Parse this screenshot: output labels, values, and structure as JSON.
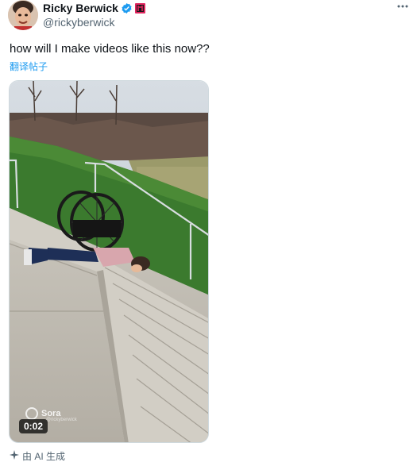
{
  "author": {
    "display_name": "Ricky Berwick",
    "handle": "@rickyberwick",
    "verified_icon": "verified-badge-icon",
    "affiliate_icon": "affiliate-badge-icon"
  },
  "more_icon": "more-options-icon",
  "tweet": {
    "text": "how will I make videos like this now??",
    "translate_label": "翻译帖子"
  },
  "media": {
    "duration": "0:02",
    "watermark": "Sora",
    "watermark_sub": "@rickyberwick"
  },
  "ai_note": {
    "icon": "sparkle-icon",
    "label": "由 AI 生成"
  },
  "colors": {
    "accent": "#1d9bf0",
    "secondary_text": "#536471",
    "affiliate_red": "#e0245e"
  }
}
